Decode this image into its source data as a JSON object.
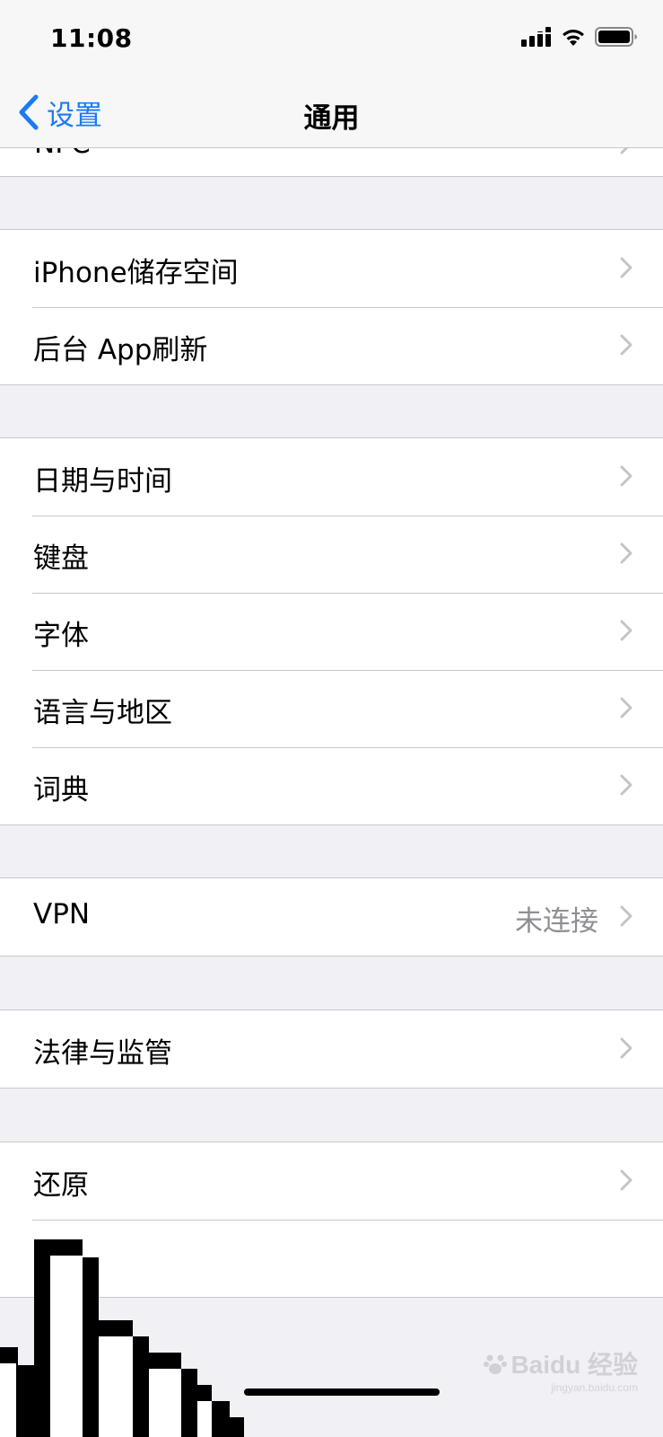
{
  "status": {
    "time": "11:08"
  },
  "nav": {
    "back_label": "设置",
    "title": "通用"
  },
  "peek_label": "NFC",
  "groups": [
    {
      "rows": [
        {
          "label": "iPhone储存空间"
        },
        {
          "label": "后台 App刷新"
        }
      ]
    },
    {
      "rows": [
        {
          "label": "日期与时间"
        },
        {
          "label": "键盘"
        },
        {
          "label": "字体"
        },
        {
          "label": "语言与地区"
        },
        {
          "label": "词典"
        }
      ]
    },
    {
      "rows": [
        {
          "label": "VPN",
          "value": "未连接"
        }
      ]
    },
    {
      "rows": [
        {
          "label": "法律与监管"
        }
      ]
    },
    {
      "rows": [
        {
          "label": "还原"
        },
        {
          "label": ""
        }
      ]
    }
  ],
  "watermark": {
    "main": "Baidu 经验",
    "sub": "jingyan.baidu.com"
  },
  "colors": {
    "accent": "#1a7cf5",
    "background": "#f0f0f5",
    "separator": "#c8c7cc",
    "chevron": "#c4c4c9"
  },
  "icons": [
    "cellular-signal-icon",
    "wifi-icon",
    "battery-icon",
    "chevron-left-icon",
    "chevron-right-icon",
    "pointer-hand-icon",
    "paw-icon"
  ]
}
